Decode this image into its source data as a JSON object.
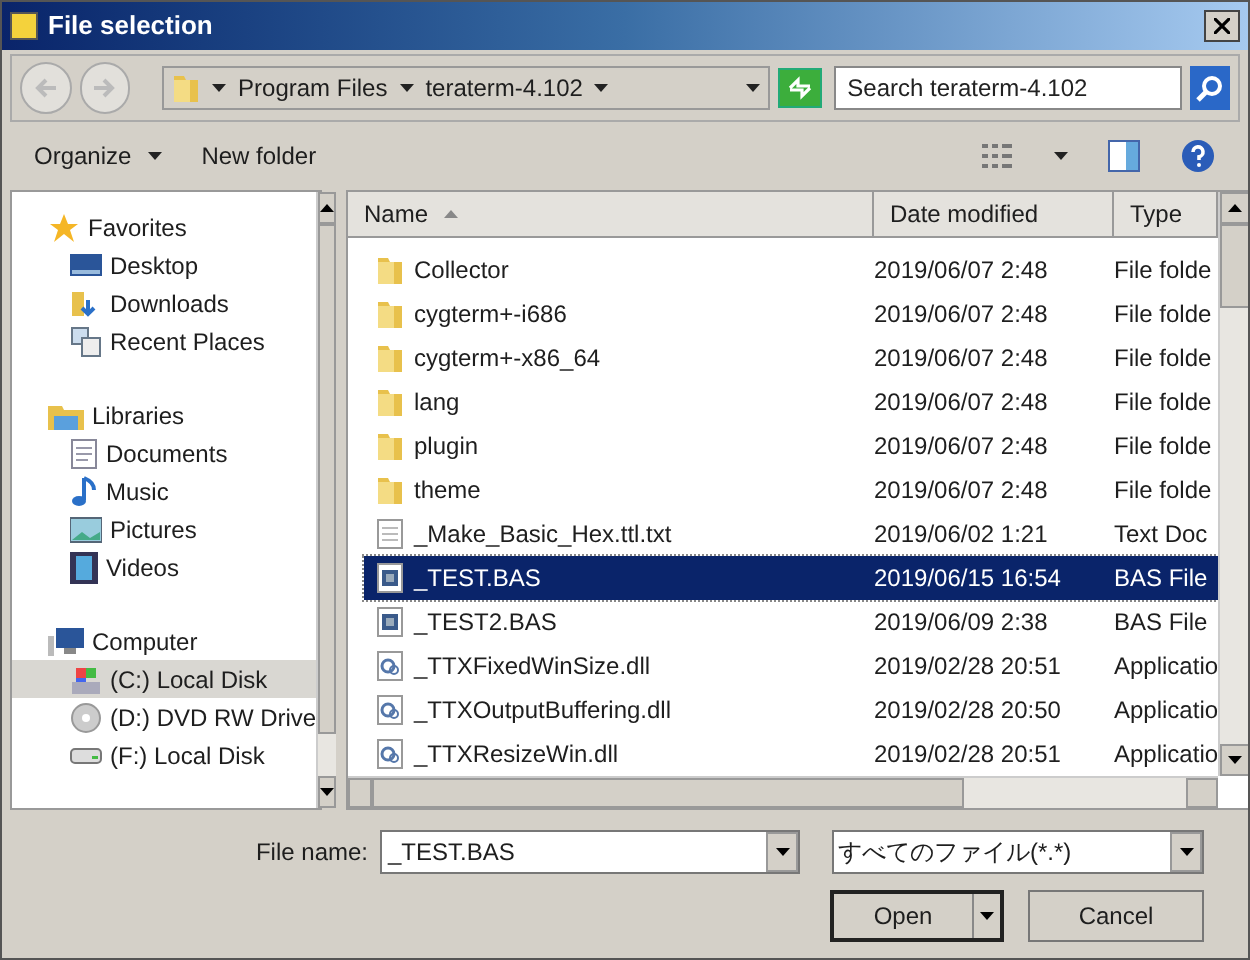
{
  "window": {
    "title": "File selection"
  },
  "breadcrumb": [
    "Program Files",
    "teraterm-4.102"
  ],
  "search": {
    "placeholder": "Search teraterm-4.102"
  },
  "toolbar": {
    "organize": "Organize",
    "new_folder": "New folder"
  },
  "sidebar": {
    "groups": [
      {
        "label": "Favorites",
        "children": [
          {
            "label": "Desktop",
            "selected": false
          },
          {
            "label": "Downloads",
            "selected": false
          },
          {
            "label": "Recent Places",
            "selected": false
          }
        ]
      },
      {
        "label": "Libraries",
        "children": [
          {
            "label": "Documents",
            "selected": false
          },
          {
            "label": "Music",
            "selected": false
          },
          {
            "label": "Pictures",
            "selected": false
          },
          {
            "label": "Videos",
            "selected": false
          }
        ]
      },
      {
        "label": "Computer",
        "children": [
          {
            "label": "(C:) Local Disk",
            "selected": true
          },
          {
            "label": "(D:) DVD RW Drive",
            "selected": false
          },
          {
            "label": "(F:) Local Disk",
            "selected": false
          }
        ]
      }
    ]
  },
  "table": {
    "columns": [
      "Name",
      "Date modified",
      "Type"
    ],
    "rows": [
      {
        "kind": "folder",
        "name": "Collector",
        "date": "2019/06/07 2:48",
        "type": "File folde",
        "selected": false
      },
      {
        "kind": "folder",
        "name": "cygterm+-i686",
        "date": "2019/06/07 2:48",
        "type": "File folde",
        "selected": false
      },
      {
        "kind": "folder",
        "name": "cygterm+-x86_64",
        "date": "2019/06/07 2:48",
        "type": "File folde",
        "selected": false
      },
      {
        "kind": "folder",
        "name": "lang",
        "date": "2019/06/07 2:48",
        "type": "File folde",
        "selected": false
      },
      {
        "kind": "folder",
        "name": "plugin",
        "date": "2019/06/07 2:48",
        "type": "File folde",
        "selected": false
      },
      {
        "kind": "folder",
        "name": "theme",
        "date": "2019/06/07 2:48",
        "type": "File folde",
        "selected": false
      },
      {
        "kind": "text",
        "name": "_Make_Basic_Hex.ttl.txt",
        "date": "2019/06/02 1:21",
        "type": "Text Doc",
        "selected": false
      },
      {
        "kind": "script",
        "name": "_TEST.BAS",
        "date": "2019/06/15 16:54",
        "type": "BAS File",
        "selected": true
      },
      {
        "kind": "script",
        "name": "_TEST2.BAS",
        "date": "2019/06/09 2:38",
        "type": "BAS File",
        "selected": false
      },
      {
        "kind": "library",
        "name": "_TTXFixedWinSize.dll",
        "date": "2019/02/28 20:51",
        "type": "Applicatio",
        "selected": false
      },
      {
        "kind": "library",
        "name": "_TTXOutputBuffering.dll",
        "date": "2019/02/28 20:50",
        "type": "Applicatio",
        "selected": false
      },
      {
        "kind": "library",
        "name": "_TTXResizeWin.dll",
        "date": "2019/02/28 20:51",
        "type": "Applicatio",
        "selected": false
      }
    ]
  },
  "file_name": {
    "label": "File name:",
    "value": "_TEST.BAS"
  },
  "file_type": {
    "value": "すべてのファイル(*.*)"
  },
  "buttons": {
    "open": "Open",
    "cancel": "Cancel"
  }
}
